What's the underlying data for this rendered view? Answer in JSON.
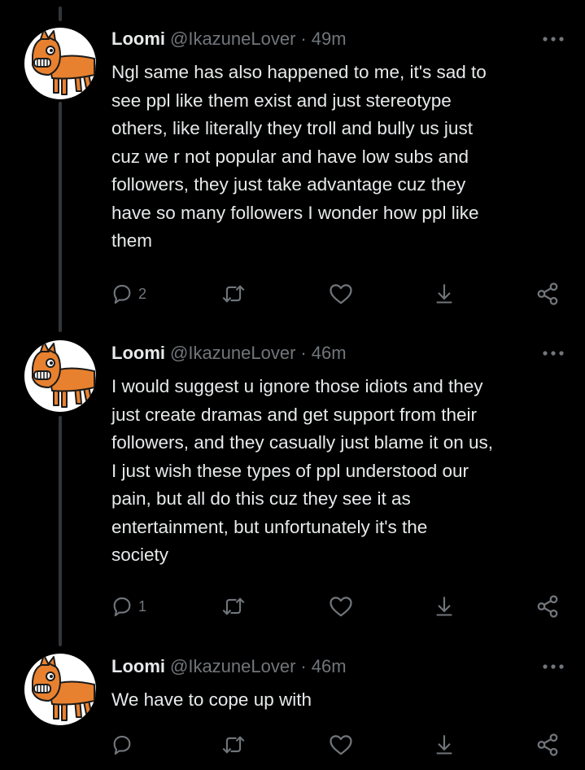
{
  "colors": {
    "background": "#000000",
    "primary_text": "#e7e9ea",
    "secondary_text": "#71767b",
    "thread_line": "#333639",
    "avatar_bg": "#ffffff",
    "avatar_horse": "#e8812f"
  },
  "tweets": [
    {
      "display_name": "Loomi",
      "handle": "@IkazuneLover",
      "separator": "·",
      "time": "49m",
      "text": "Ngl same has also happened to me, it's sad to\nsee ppl like them exist and just stereotype\nothers, like literally they troll and bully us just\ncuz we r not popular and have low subs and\nfollowers, they just take advantage cuz they\nhave so many followers I wonder how ppl like\nthem",
      "reply_count": "2",
      "icons": [
        "more-icon",
        "reply-icon",
        "retweet-icon",
        "like-icon",
        "download-icon",
        "share-icon"
      ]
    },
    {
      "display_name": "Loomi",
      "handle": "@IkazuneLover",
      "separator": "·",
      "time": "46m",
      "text": "I would suggest u ignore those idiots  and they\njust create dramas and get support from their\nfollowers, and they casually just blame it on us,\nI just wish these types of ppl understood our\npain, but all do this cuz they see it as\nentertainment, but unfortunately it's the\nsociety",
      "reply_count": "1",
      "icons": [
        "more-icon",
        "reply-icon",
        "retweet-icon",
        "like-icon",
        "download-icon",
        "share-icon"
      ]
    },
    {
      "display_name": "Loomi",
      "handle": "@IkazuneLover",
      "separator": "·",
      "time": "46m",
      "text": "We have to cope up with",
      "reply_count": "",
      "icons": [
        "more-icon",
        "reply-icon",
        "retweet-icon",
        "like-icon",
        "download-icon",
        "share-icon"
      ]
    }
  ]
}
